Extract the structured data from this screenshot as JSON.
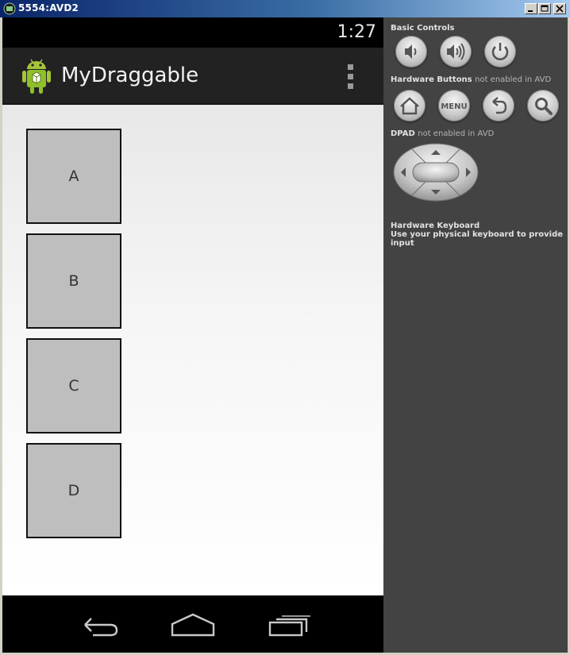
{
  "window": {
    "title": "5554:AVD2"
  },
  "device": {
    "status_time": "1:27",
    "app_title": "MyDraggable",
    "boxes": [
      "A",
      "B",
      "C",
      "D"
    ]
  },
  "controls": {
    "basic_controls_label": "Basic Controls",
    "hardware_buttons_label": "Hardware Buttons",
    "hardware_buttons_note": "not enabled in AVD",
    "menu_label": "MENU",
    "dpad_label": "DPAD",
    "dpad_note": "not enabled in AVD",
    "keyboard_label": "Hardware Keyboard",
    "keyboard_hint": "Use your physical keyboard to provide input"
  },
  "colors": {
    "action_bar": "#222222",
    "box_fill": "#bebebe",
    "panel_bg": "#434343"
  }
}
